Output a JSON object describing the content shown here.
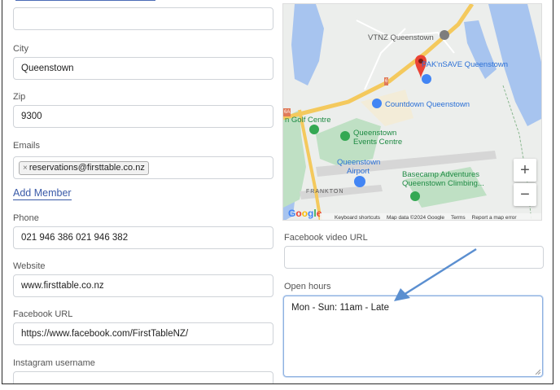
{
  "form": {
    "city_label": "City",
    "city_value": "Queenstown",
    "zip_label": "Zip",
    "zip_value": "9300",
    "emails_label": "Emails",
    "email_tag": "reservations@firsttable.co.nz",
    "email_tag_remove": "×",
    "add_member": "Add Member",
    "phone_label": "Phone",
    "phone_value": "021 946 386 021 946 382",
    "website_label": "Website",
    "website_value": "www.firsttable.co.nz",
    "facebook_label": "Facebook URL",
    "facebook_value": "https://www.facebook.com/FirstTableNZ/",
    "instagram_label": "Instagram username",
    "fb_video_label": "Facebook video URL",
    "fb_video_value": "",
    "open_hours_label": "Open hours",
    "open_hours_value": "Mon - Sun: 11am - Late"
  },
  "map": {
    "places": {
      "vtnz": "VTNZ Queenstown",
      "paknsave": "PAK'nSAVE Queenstown",
      "countdown": "Countdown Queenstown",
      "golf": "n Golf Centre",
      "events_1": "Queenstown",
      "events_2": "Events Centre",
      "airport_1": "Queenstown",
      "airport_2": "Airport",
      "basecamp_1": "Basecamp Adventures",
      "basecamp_2": "Queenstown Climbing...",
      "frankton": "FRANKTON",
      "road_6": "6",
      "road_6a": "6A"
    },
    "zoom_in": "+",
    "zoom_out": "−",
    "google": "Google",
    "attribution": {
      "shortcuts": "Keyboard shortcuts",
      "mapdata": "Map data ©2024 Google",
      "terms": "Terms",
      "report": "Report a map error"
    }
  },
  "colors": {
    "accent": "#4b6cb7",
    "link": "#3a5aa8",
    "arrow": "#5b8fd0",
    "map_water": "#a7c4ef",
    "map_park": "#bfe0c4",
    "map_road": "#f4c95d",
    "pin_red": "#ea4335",
    "pin_blue": "#4285f4",
    "pin_green": "#34a853"
  }
}
